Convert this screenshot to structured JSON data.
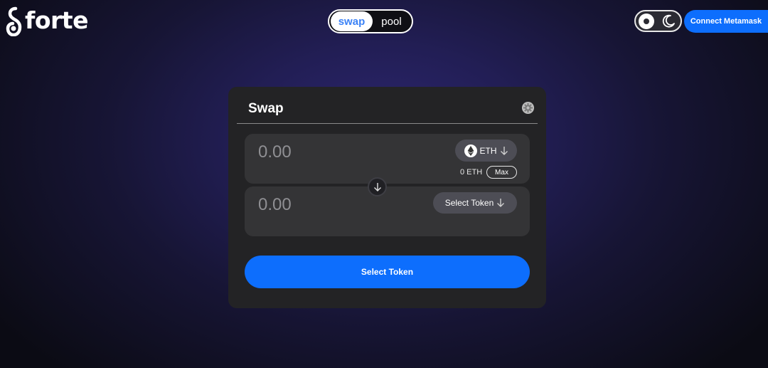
{
  "brand": {
    "name": "forte"
  },
  "nav": {
    "tabs": [
      {
        "label": "swap",
        "active": true
      },
      {
        "label": "pool",
        "active": false
      }
    ]
  },
  "theme": {
    "mode": "dark",
    "light_icon": "sun-icon",
    "dark_icon": "moon-icon"
  },
  "header": {
    "connect_label": "Connect Metamask"
  },
  "swap": {
    "title": "Swap",
    "settings_icon": "gear-icon",
    "from": {
      "amount_placeholder": "0.00",
      "token_label": "ETH",
      "token_icon": "ethereum-icon",
      "balance": "0 ETH",
      "max_label": "Max"
    },
    "to": {
      "amount_placeholder": "0.00",
      "token_label": "Select Token"
    },
    "switch_icon": "arrow-down-icon",
    "submit_label": "Select Token"
  },
  "colors": {
    "accent": "#0d6efd",
    "tab_active_text": "#3b82f6",
    "card_bg": "#232325",
    "field_bg": "#343436"
  }
}
